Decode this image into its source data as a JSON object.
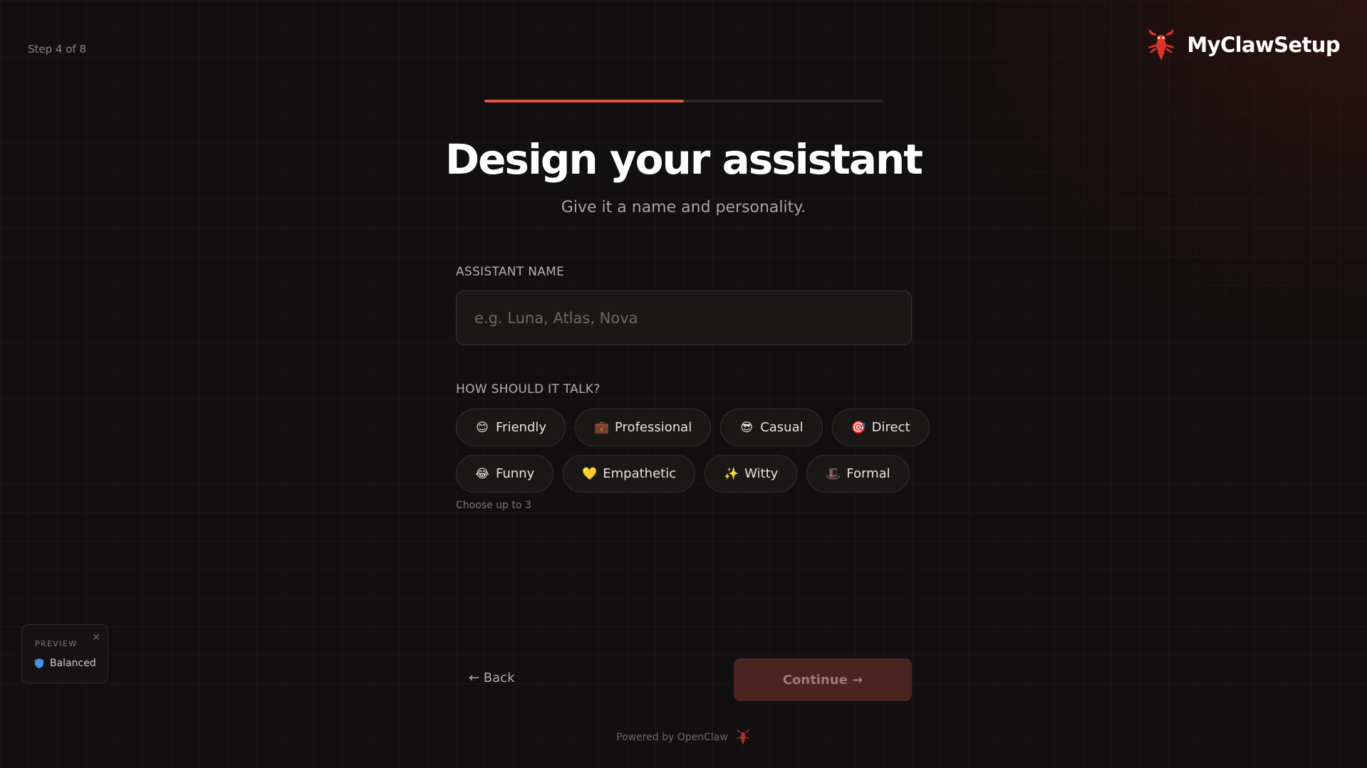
{
  "header": {
    "step": "Step 4 of 8",
    "brand_name": "MyClawSetup",
    "progress": 0.5
  },
  "main": {
    "title": "Design your assistant",
    "subtitle": "Give it a name and personality."
  },
  "form": {
    "name_label": "ASSISTANT NAME",
    "name_placeholder": "e.g. Luna, Atlas, Nova",
    "name_value": "",
    "tone_label": "HOW SHOULD IT TALK?",
    "tone_hint": "Choose up to 3",
    "tones_row1": [
      {
        "emoji": "😊",
        "label": "Friendly"
      },
      {
        "emoji": "💼",
        "label": "Professional"
      },
      {
        "emoji": "😎",
        "label": "Casual"
      },
      {
        "emoji": "🎯",
        "label": "Direct"
      }
    ],
    "tones_row2": [
      {
        "emoji": "😂",
        "label": "Funny"
      },
      {
        "emoji": "💛",
        "label": "Empathetic"
      },
      {
        "emoji": "✨",
        "label": "Witty"
      },
      {
        "emoji": "🎩",
        "label": "Formal"
      }
    ]
  },
  "nav": {
    "back_label": "← Back",
    "continue_label": "Continue →"
  },
  "footer": {
    "text": "Powered by OpenClaw"
  },
  "preview": {
    "label": "PREVIEW",
    "value": "Balanced"
  },
  "colors": {
    "accent": "#e4553f",
    "continue_bg": "#4a2421",
    "background": "#110f0f"
  }
}
